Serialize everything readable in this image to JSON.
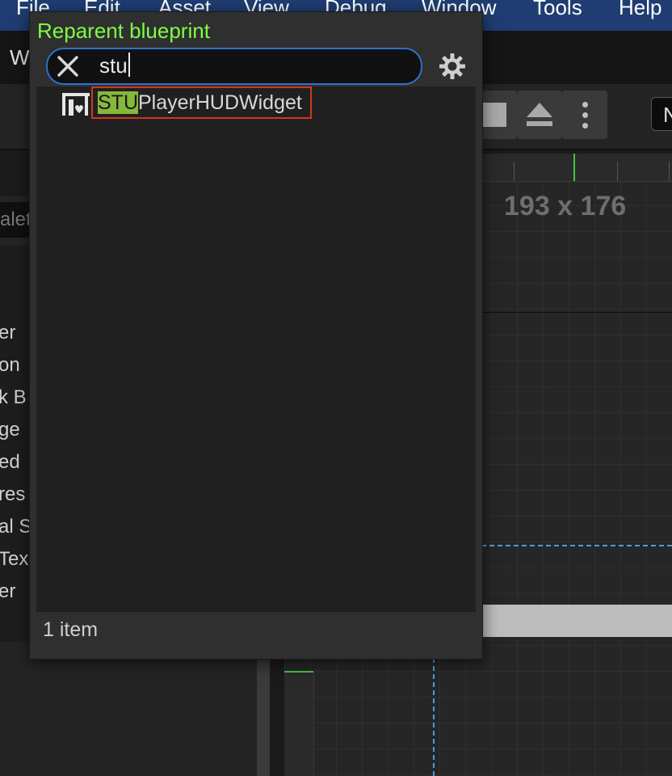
{
  "menubar": {
    "items": [
      "File",
      "Edit",
      "Asset",
      "View",
      "Debug",
      "Window",
      "Tools",
      "Help"
    ]
  },
  "tab": {
    "label_fragment": "W"
  },
  "toolbar": {
    "mode_fragment": "N"
  },
  "left_panel": {
    "search_fragment": "alet",
    "items": [
      "er",
      "on",
      "k B",
      "ge",
      "ed",
      "res",
      "al S",
      "Tex",
      "er"
    ]
  },
  "canvas": {
    "dimensions": "193 x 176"
  },
  "popup": {
    "title": "Reparent blueprint",
    "search": {
      "value": "stu"
    },
    "results": [
      {
        "match": "STU",
        "rest": "PlayerHUDWidget",
        "icon": "widget-blueprint-icon"
      }
    ],
    "count": "1 item"
  },
  "colors": {
    "title_green": "#7cff42",
    "match_highlight": "#86b83c",
    "selection_outline": "#d4371c",
    "focus_blue": "#2f6fd0",
    "menubar": "#1f3d72"
  }
}
